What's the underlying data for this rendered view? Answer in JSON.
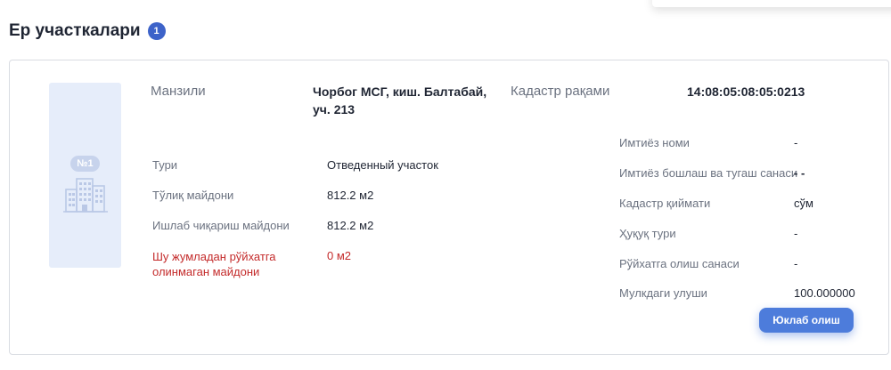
{
  "section": {
    "title": "Ер участкалари",
    "count": "1"
  },
  "plot": {
    "badge": "№1",
    "address_label": "Манзили",
    "address_value": "Чорбог МСГ, киш. Балтабай, уч. 213",
    "cadastre_label": "Кадастр рақами",
    "cadastre_value": "14:08:05:08:05:0213",
    "left_fields": [
      {
        "label": "Тури",
        "value": "Отведенный участок"
      },
      {
        "label": "Тўлиқ майдони",
        "value": "812.2 м2"
      },
      {
        "label": "Ишлаб чиқариш майдони",
        "value": "812.2 м2"
      },
      {
        "label": "Шу жумладан рўйхатга олинмаган майдони",
        "value": "0 м2"
      }
    ],
    "right_fields": [
      {
        "label": "Имтиёз номи",
        "value": "-"
      },
      {
        "label": "Имтиёз бошлаш ва тугаш санаси",
        "value": "- -"
      },
      {
        "label": "Кадастр қиймати",
        "value": "сўм"
      },
      {
        "label": "Ҳуқуқ тури",
        "value": "-"
      },
      {
        "label": "Рўйхатга олиш санаси",
        "value": "-"
      },
      {
        "label": "Мулкдаги улуши",
        "value": "100.000000"
      }
    ],
    "download_label": "Юклаб олиш"
  },
  "colors": {
    "accent": "#4d7cdb",
    "badge": "#3d63c9",
    "warning": "#c42b2b",
    "thumb_bg": "#e6edfa"
  },
  "icons": {
    "thumbnail": "building-icon"
  }
}
